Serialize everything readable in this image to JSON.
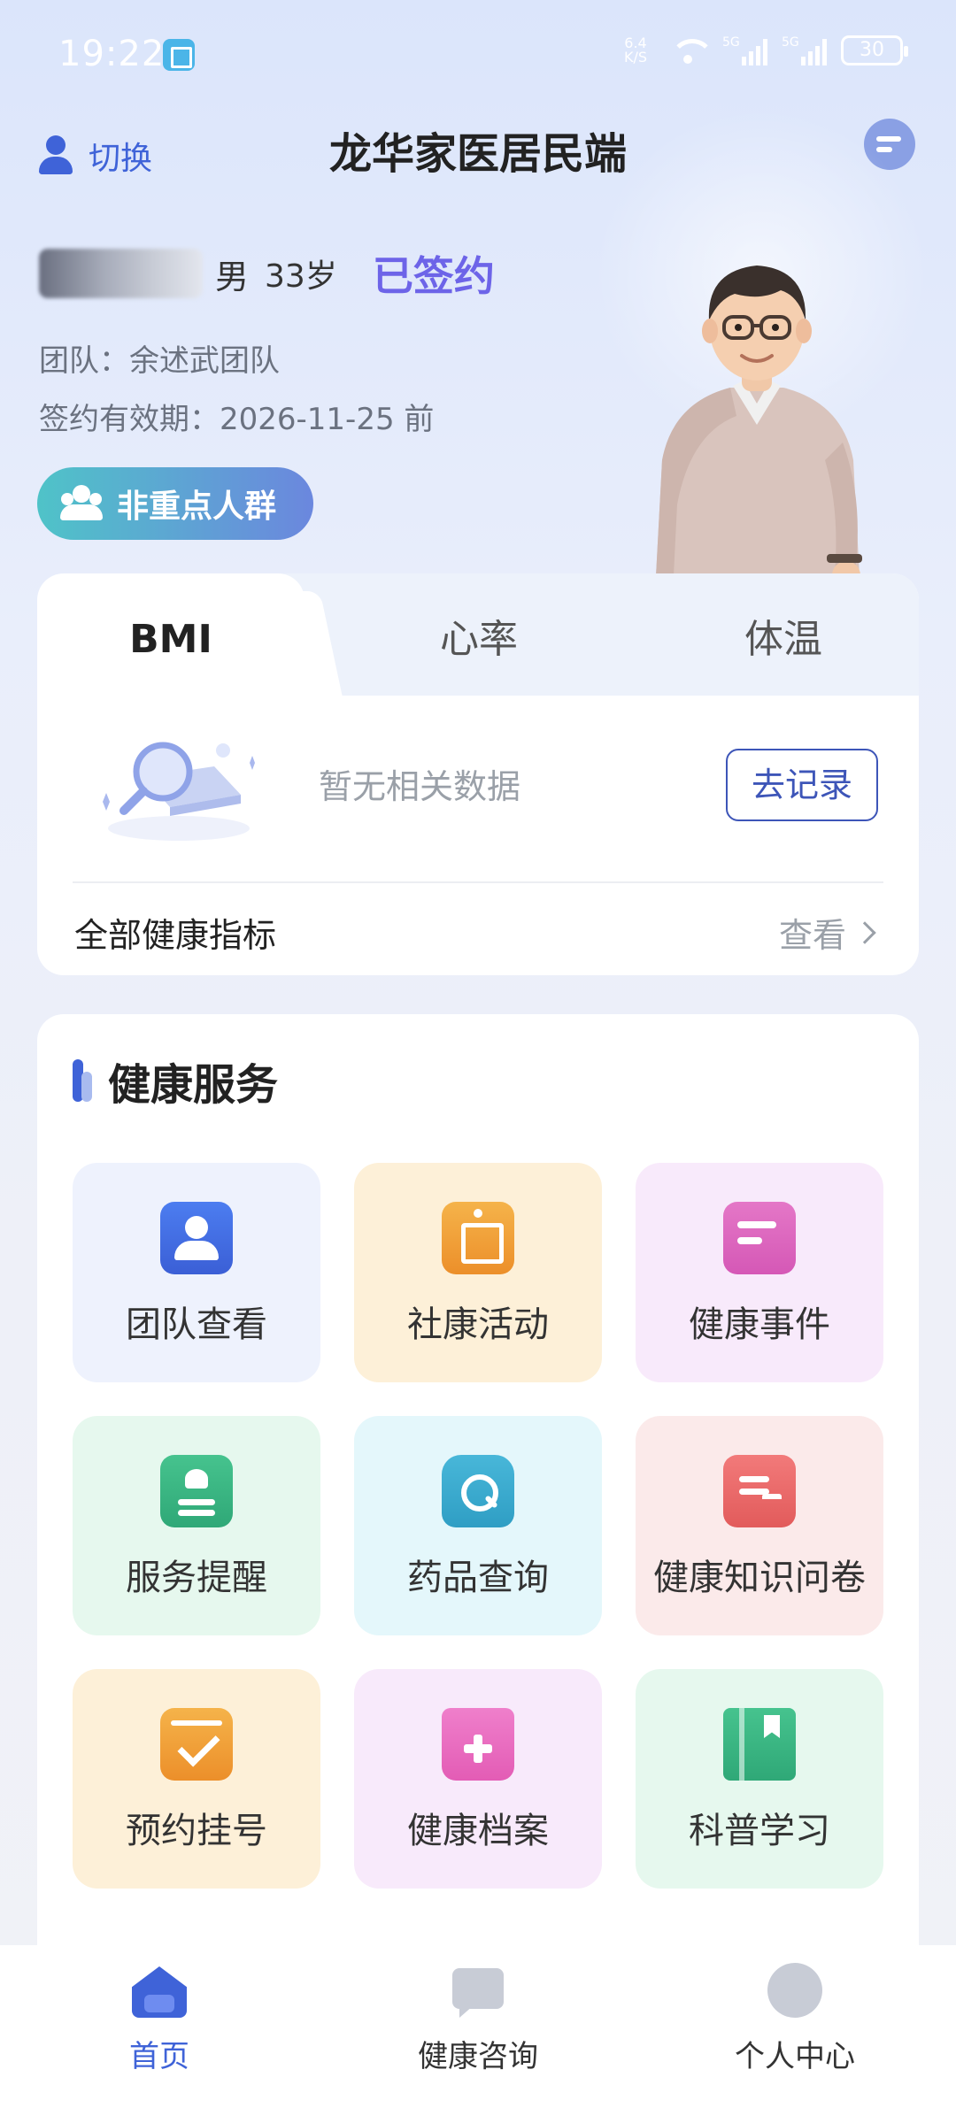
{
  "status_bar": {
    "time": "19:22",
    "net_speed_top": "6.4",
    "net_speed_bottom": "K/S",
    "sim1": "5G",
    "sim2": "5G",
    "battery": "30"
  },
  "header": {
    "switch_label": "切换",
    "title": "龙华家医居民端"
  },
  "profile": {
    "gender": "男",
    "age": "33岁",
    "sign_status": "已签约",
    "team": "团队：余述武团队",
    "valid_until": "签约有效期：2026-11-25 前",
    "group_tag": "非重点人群"
  },
  "metrics": {
    "tabs": [
      {
        "label": "BMI",
        "active": true
      },
      {
        "label": "心率",
        "active": false
      },
      {
        "label": "体温",
        "active": false
      }
    ],
    "empty_text": "暂无相关数据",
    "record_button": "去记录",
    "all_label": "全部健康指标",
    "view_label": "查看"
  },
  "services": {
    "title": "健康服务",
    "items": [
      {
        "label": "团队查看",
        "icon": "team-icon",
        "bg": "#eef2fd"
      },
      {
        "label": "社康活动",
        "icon": "activity-icon",
        "bg": "#fdf0d8"
      },
      {
        "label": "健康事件",
        "icon": "event-icon",
        "bg": "#f8eafb"
      },
      {
        "label": "服务提醒",
        "icon": "remind-icon",
        "bg": "#e6f8ee"
      },
      {
        "label": "药品查询",
        "icon": "drug-icon",
        "bg": "#e4f7fb"
      },
      {
        "label": "健康知识问卷",
        "icon": "quiz-icon",
        "bg": "#fbeaea"
      },
      {
        "label": "预约挂号",
        "icon": "booking-icon",
        "bg": "#fdf0d8"
      },
      {
        "label": "健康档案",
        "icon": "archive-icon",
        "bg": "#f8eafb"
      },
      {
        "label": "科普学习",
        "icon": "study-icon",
        "bg": "#e6f8ee"
      }
    ]
  },
  "bottom_nav": {
    "items": [
      {
        "label": "首页",
        "icon": "home-icon",
        "active": true
      },
      {
        "label": "健康咨询",
        "icon": "chat-icon",
        "active": false
      },
      {
        "label": "个人中心",
        "icon": "profile-icon",
        "active": false
      }
    ]
  },
  "colors": {
    "accent": "#3f63d8",
    "signed": "#6d64e8"
  }
}
